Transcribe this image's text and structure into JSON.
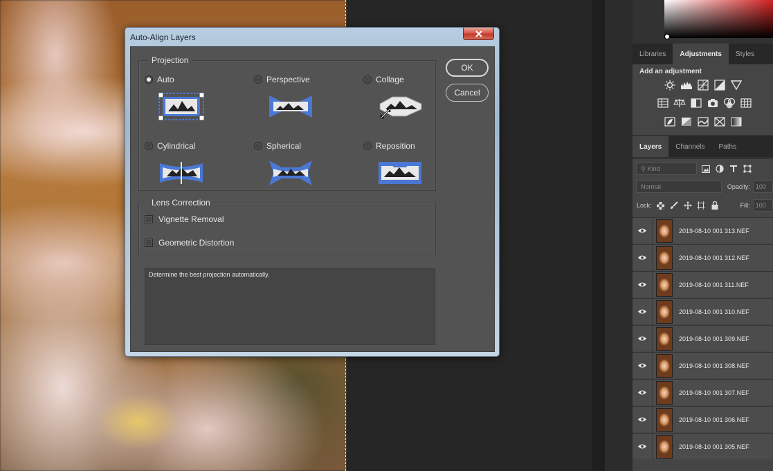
{
  "dialog": {
    "title": "Auto-Align Layers",
    "projection": {
      "title": "Projection",
      "options": [
        {
          "label": "Auto",
          "selected": true,
          "icon": "auto-projection-icon"
        },
        {
          "label": "Perspective",
          "selected": false,
          "icon": "perspective-projection-icon"
        },
        {
          "label": "Collage",
          "selected": false,
          "icon": "collage-projection-icon"
        },
        {
          "label": "Cylindrical",
          "selected": false,
          "icon": "cylindrical-projection-icon"
        },
        {
          "label": "Spherical",
          "selected": false,
          "icon": "spherical-projection-icon"
        },
        {
          "label": "Reposition",
          "selected": false,
          "icon": "reposition-projection-icon"
        }
      ]
    },
    "lens": {
      "title": "Lens Correction",
      "options": [
        {
          "label": "Vignette Removal",
          "checked": false
        },
        {
          "label": "Geometric Distortion",
          "checked": false
        }
      ]
    },
    "description": "Determine the best projection automatically.",
    "ok_label": "OK",
    "cancel_label": "Cancel"
  },
  "panels": {
    "top_tabs": [
      "Libraries",
      "Adjustments",
      "Styles"
    ],
    "active_top_tab": "Adjustments",
    "adjustments_title": "Add an adjustment",
    "layer_tabs": [
      "Layers",
      "Channels",
      "Paths"
    ],
    "active_layer_tab": "Layers",
    "kind_placeholder": "Kind",
    "blend_mode": "Normal",
    "opacity_label": "Opacity:",
    "opacity_value": "100",
    "lock_label": "Lock:",
    "fill_label": "Fill:",
    "fill_value": "100",
    "layers": [
      "2019-08-10 001 313.NEF",
      "2019-08-10 001 312.NEF",
      "2019-08-10 001 311.NEF",
      "2019-08-10 001 310.NEF",
      "2019-08-10 001 309.NEF",
      "2019-08-10 001 308.NEF",
      "2019-08-10 001 307.NEF",
      "2019-08-10 001 306.NEF",
      "2019-08-10 001 305.NEF"
    ]
  },
  "colors": {
    "projection_blue": "#4a78d4",
    "dialog_body": "#535353",
    "close_red": "#c23a2b"
  }
}
